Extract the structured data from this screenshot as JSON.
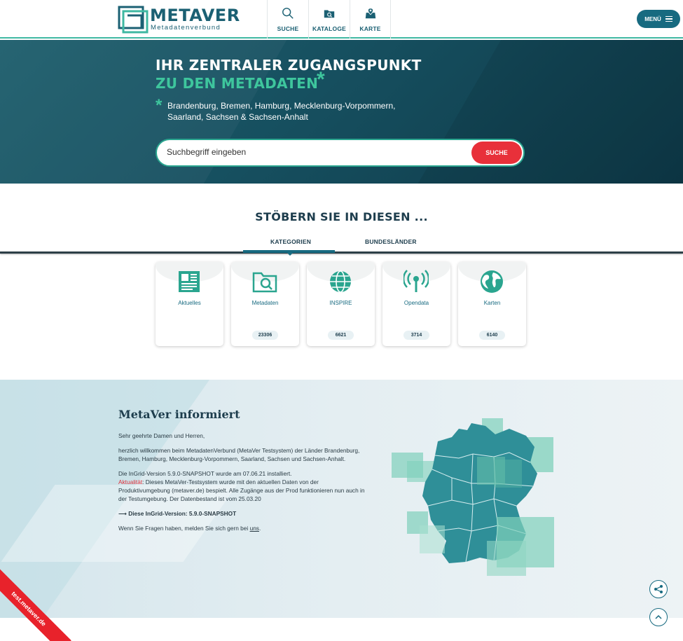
{
  "header": {
    "logo": {
      "name": "METAVER",
      "sub": "Metadatenverbund"
    },
    "nav": [
      {
        "label": "SUCHE",
        "icon": "search-icon"
      },
      {
        "label": "KATALOGE",
        "icon": "catalog-folder-icon"
      },
      {
        "label": "KARTE",
        "icon": "map-pin-icon"
      }
    ],
    "menu_label": "MENÜ"
  },
  "hero": {
    "title_line1": "IHR ZENTRALER ZUGANGSPUNKT",
    "title_line2": "ZU DEN METADATEN",
    "asterisk": "*",
    "states": "Brandenburg, Bremen, Hamburg, Mecklenburg-Vorpommern, Saarland, Sachsen & Sachsen-Anhalt",
    "search": {
      "placeholder": "Suchbegriff eingeben",
      "button": "SUCHE"
    }
  },
  "browse": {
    "title": "STÖBERN SIE IN DIESEN ...",
    "tabs": [
      {
        "label": "KATEGORIEN",
        "active": true
      },
      {
        "label": "BUNDESLÄNDER",
        "active": false
      }
    ],
    "cards": [
      {
        "label": "Aktuelles",
        "count": "",
        "icon": "news-icon"
      },
      {
        "label": "Metadaten",
        "count": "23306",
        "icon": "folder-search-icon"
      },
      {
        "label": "INSPIRE",
        "count": "6621",
        "icon": "globe-icon"
      },
      {
        "label": "Opendata",
        "count": "3714",
        "icon": "antenna-icon"
      },
      {
        "label": "Karten",
        "count": "6140",
        "icon": "earth-icon"
      }
    ]
  },
  "info": {
    "title": "MetaVer informiert",
    "greeting": "Sehr geehrte Damen und Herren,",
    "welcome": "herzlich willkommen beim MetadatenVerbund (MetaVer Testsystem) der Länder Brandenburg, Bremen, Hamburg, Mecklenburg-Vorpommern, Saarland, Sachsen und Sachsen-Anhalt.",
    "version_installed": "Die InGrid-Version 5.9.0-SNAPSHOT wurde am 07.06.21 installiert.",
    "actuality_label": "Aktualität",
    "actuality_text": ": Dieses MetaVer-Testsystem wurde mit den aktuellen Daten von der Produktivumgebung (metaver.de) bespielt. Alle Zugänge aus der Prod funktionieren nun auch in der Testumgebung. Der Datenbestand ist vom 25.03.20",
    "current_version": "⟶ Diese InGrid-Version: 5.9.0-SNAPSHOT",
    "contact_prefix": "Wenn Sie Fragen haben, melden Sie sich gern bei ",
    "contact_link": "uns",
    "contact_suffix": "."
  },
  "ribbon": "test.metaver.de",
  "colors": {
    "primary": "#176a80",
    "accent": "#3ec69d",
    "danger": "#e8303a"
  }
}
